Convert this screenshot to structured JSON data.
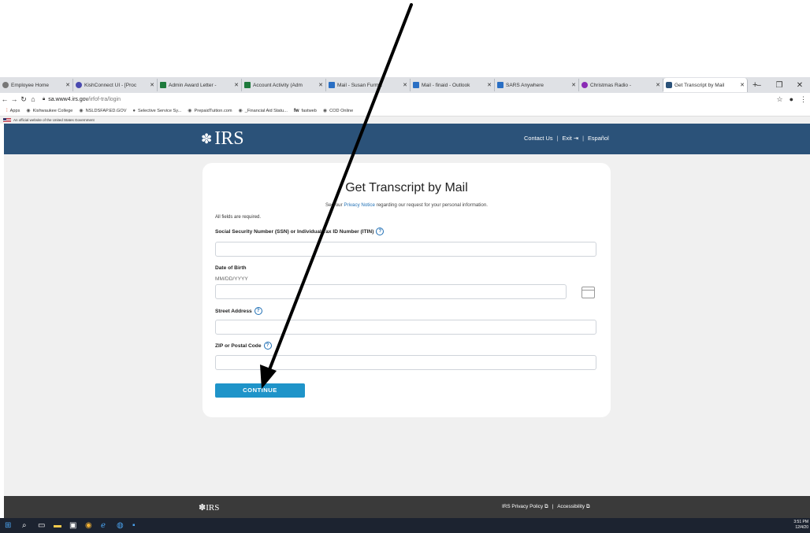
{
  "browser": {
    "tabs": [
      {
        "label": "Employee Home",
        "color": "#777"
      },
      {
        "label": "KishConnect UI - [Proc",
        "color": "#4a4ab0"
      },
      {
        "label": "Admin Award Letter -",
        "color": "#1e7a3c"
      },
      {
        "label": "Account Activity (Adm",
        "color": "#1e7a3c"
      },
      {
        "label": "Mail - Susan Furma",
        "color": "#2a6fc4"
      },
      {
        "label": "Mail - finaid - Outlook",
        "color": "#2a6fc4"
      },
      {
        "label": "SARS Anywhere",
        "color": "#2a6fc4"
      },
      {
        "label": "Christmas Radio -",
        "color": "#8a2bb5"
      },
      {
        "label": "Get Transcript by Mail",
        "color": "#2b5279"
      }
    ],
    "new_tab": "+",
    "url_host": "sa.www4.irs.gov",
    "url_path": "/irfof-tra/login",
    "bookmarks": [
      "Apps",
      "Kishwaukee College",
      "NSLDSFAP.ED.GOV",
      "Selective Service Sy...",
      "PrepaidTuition.com",
      "_Financial Aid Statu...",
      "fastweb",
      "COD Online"
    ]
  },
  "gov_banner": "An official website of the United States Government",
  "header": {
    "logo": "IRS",
    "links": [
      "Contact Us",
      "Exit",
      "Español"
    ]
  },
  "form": {
    "title": "Get Transcript by Mail",
    "privacy_prefix": "See our ",
    "privacy_link": "Privacy Notice",
    "privacy_suffix": " regarding our request for your personal information.",
    "required_note": "All fields are required.",
    "ssn_label": "Social Security Number (SSN) or Individual Tax ID Number (ITIN)",
    "dob_label": "Date of Birth",
    "dob_hint": "MM/DD/YYYY",
    "street_label": "Street Address",
    "zip_label": "ZIP or Postal Code",
    "continue_label": "CONTINUE"
  },
  "footer": {
    "logo": "IRS",
    "links": [
      "IRS Privacy Policy",
      "Accessibility"
    ]
  },
  "taskbar": {
    "time": "3:51 PM",
    "date": "12/4/20"
  },
  "colors": {
    "irs_blue": "#2b5279",
    "button": "#1f94c9",
    "footer": "#3a3a3a",
    "link": "#1f6fb5"
  }
}
